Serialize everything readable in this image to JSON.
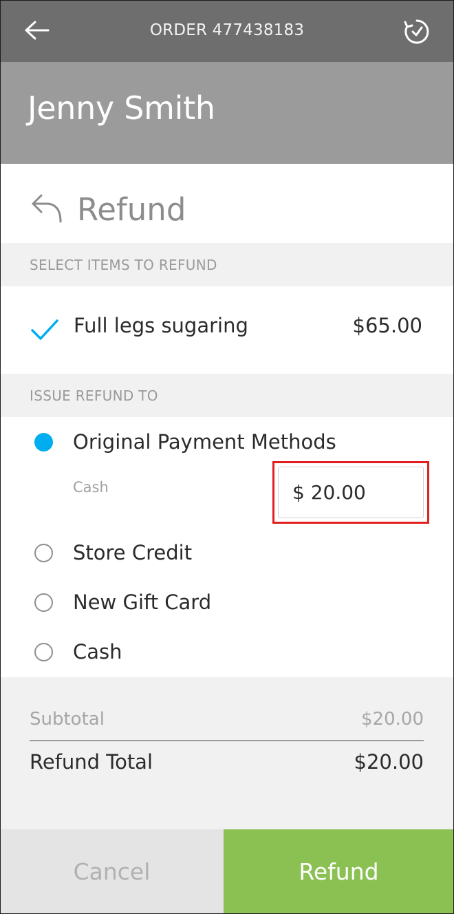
{
  "header": {
    "order_title": "ORDER 477438183",
    "back_icon": "arrow-left-icon",
    "history_icon": "clock-history-icon"
  },
  "customer": {
    "name": "Jenny Smith"
  },
  "refund": {
    "title": "Refund",
    "title_icon": "undo-arrow-icon"
  },
  "items_section": {
    "header": "SELECT ITEMS TO REFUND",
    "items": [
      {
        "name": "Full legs sugaring",
        "price": "$65.00",
        "checked": true
      }
    ]
  },
  "issue_section": {
    "header": "ISSUE REFUND TO",
    "options": [
      {
        "label": "Original Payment Methods",
        "selected": true
      },
      {
        "label": "Store Credit",
        "selected": false
      },
      {
        "label": "New Gift Card",
        "selected": false
      },
      {
        "label": "Cash",
        "selected": false
      }
    ],
    "original_method_label": "Cash",
    "original_method_amount": "$ 20.00"
  },
  "totals": {
    "subtotal_label": "Subtotal",
    "subtotal_value": "$20.00",
    "total_label": "Refund Total",
    "total_value": "$20.00"
  },
  "actions": {
    "cancel_label": "Cancel",
    "refund_label": "Refund"
  },
  "colors": {
    "topbar": "#6e6e6e",
    "customer_header": "#9b9b9b",
    "accent_blue": "#00aeef",
    "refund_green": "#8bc053",
    "highlight_red": "#e02020"
  }
}
